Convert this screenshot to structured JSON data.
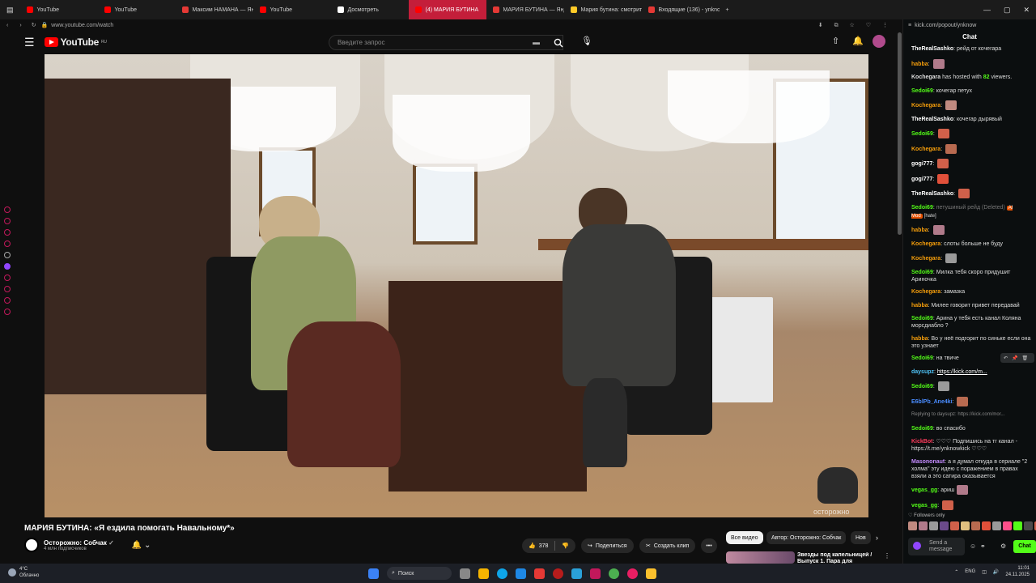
{
  "browser": {
    "tabs": [
      {
        "label": "YouTube",
        "color": "#ff0000"
      },
      {
        "label": "YouTube",
        "color": "#ff0000"
      },
      {
        "label": "Максим НАМАНА — Янд",
        "color": "#e53935"
      },
      {
        "label": "YouTube",
        "color": "#ff0000"
      },
      {
        "label": "Досмотреть",
        "color": "#ffffff"
      },
      {
        "label": "(4) МАРИЯ БУТИНА",
        "color": "#ff0000",
        "active": true
      },
      {
        "label": "МАРИЯ БУТИНА — Янд",
        "color": "#e53935"
      },
      {
        "label": "Мария бутина: смотрит",
        "color": "#ffca28"
      },
      {
        "label": "Входящие (136) - ynkno",
        "color": "#e53935"
      }
    ],
    "new_tab": "+",
    "address": "www.youtube.com/watch",
    "chat_url": "kick.com/popout/ynknow"
  },
  "youtube": {
    "logo": "YouTube",
    "logo_region": "RU",
    "search_placeholder": "Введите запрос",
    "video_title": "МАРИЯ БУТИНА: «Я ездила помогать Навальному*»",
    "watermark": "осторожно",
    "channel_name": "Осторожно: Собчак",
    "channel_subs": "4 млн подписчиков",
    "likes": "378",
    "share_label": "Поделиться",
    "clip_label": "Создать клип",
    "more": "•••",
    "chips": [
      "Все видео",
      "Автор: Осторожно: Собчак",
      "Нов"
    ],
    "next_video_title": "Звезды под капельницей / Выпуск 1. Пара для"
  },
  "chat": {
    "title": "Chat",
    "messages": [
      {
        "user": "TheRealSashko",
        "color": "#ffffff",
        "text": "рейд от кочегара"
      },
      {
        "user": "habba",
        "color": "#f59e0b",
        "text": "",
        "emote": "#b07a8a"
      },
      {
        "system": true,
        "user": "Kochegara",
        "text_before": "has hosted with",
        "count": "82",
        "text_after": "viewers."
      },
      {
        "user": "Sedoi69",
        "color": "#53fc18",
        "text": "кочегар петух"
      },
      {
        "user": "Kochegara",
        "color": "#f59e0b",
        "text": "",
        "emote": "#c08a80"
      },
      {
        "user": "TheRealSashko",
        "color": "#ffffff",
        "text": "кочегар дырявый"
      },
      {
        "user": "Sedoi69",
        "color": "#53fc18",
        "text": "",
        "emote": "#d0604a"
      },
      {
        "user": "Kochegara",
        "color": "#f59e0b",
        "text": "",
        "emote": "#b86a50"
      },
      {
        "user": "gogi777",
        "color": "#ffffff",
        "text": "",
        "emote": "#d0604a"
      },
      {
        "user": "gogi777",
        "color": "#ffffff",
        "text": "",
        "emote": "#e0503a"
      },
      {
        "user": "TheRealSashko",
        "color": "#ffffff",
        "text": "",
        "emote": "#d0604a"
      },
      {
        "user": "Sedoi69",
        "color": "#53fc18",
        "text": "петушиный рейд (Deleted)",
        "badge": "AI Mod",
        "tag": "[hate]",
        "deleted": true
      },
      {
        "user": "habba",
        "color": "#f59e0b",
        "text": "",
        "emote": "#b07a8a"
      },
      {
        "user": "Kochegara",
        "color": "#f59e0b",
        "text": "слоты больше не буду"
      },
      {
        "user": "Kochegara",
        "color": "#f59e0b",
        "text": "",
        "emote": "#9a9a9a"
      },
      {
        "user": "Sedoi69",
        "color": "#53fc18",
        "text": "Милка тебя скоро придушит Ариночка"
      },
      {
        "user": "Kochegara",
        "color": "#f59e0b",
        "text": "замазка"
      },
      {
        "user": "habba",
        "color": "#f59e0b",
        "text": "Милее говорит привет передавай"
      },
      {
        "user": "Sedoi69",
        "color": "#53fc18",
        "text": "Арина у тебя есть канал Коляна морсдиабло ?"
      },
      {
        "user": "habba",
        "color": "#f59e0b",
        "text": "Во у неё подгорит по синьке если она это узнает"
      },
      {
        "user": "Sedoi69",
        "color": "#53fc18",
        "text": "на твиче"
      },
      {
        "user": "daysupz",
        "color": "#4fc3f7",
        "text": "https://kick.com/m...",
        "link": true
      },
      {
        "user": "Sedoi69",
        "color": "#53fc18",
        "text": "",
        "emote": "#9a9a9a"
      },
      {
        "user": "E6blPb_Ane4ki",
        "color": "#4a8cff",
        "text": "",
        "emote": "#b86a50"
      },
      {
        "reply": true,
        "text": "Replying to daysupz: https://kick.com/mor..."
      },
      {
        "user": "Sedoi69",
        "color": "#53fc18",
        "text": "во спасибо"
      },
      {
        "user": "KickBot",
        "color": "#ff3b5c",
        "text": "♡♡♡ Подпишись на тг канал - https://t.me/ynknowkick ♡♡♡"
      },
      {
        "user": "Masononaut",
        "color": "#c58cff",
        "text": "а я думал откуда в сериале \"2 холма\" эту идею с поражением в правах взяли а это сатира оказывается"
      },
      {
        "user": "vegas_gg",
        "color": "#53fc18",
        "text": "ариш",
        "emote": "#b07a8a"
      },
      {
        "user": "vegas_gg",
        "color": "#53fc18",
        "text": "",
        "emote": "#d0604a"
      }
    ],
    "followers_only": "Followers only",
    "input_placeholder": "Send a message",
    "send_label": "Chat"
  },
  "taskbar": {
    "weather_temp": "4°C",
    "weather_desc": "Облачно",
    "search_label": "Поиск",
    "lang": "ENG",
    "time": "11:01",
    "date": "24.11.2025"
  }
}
